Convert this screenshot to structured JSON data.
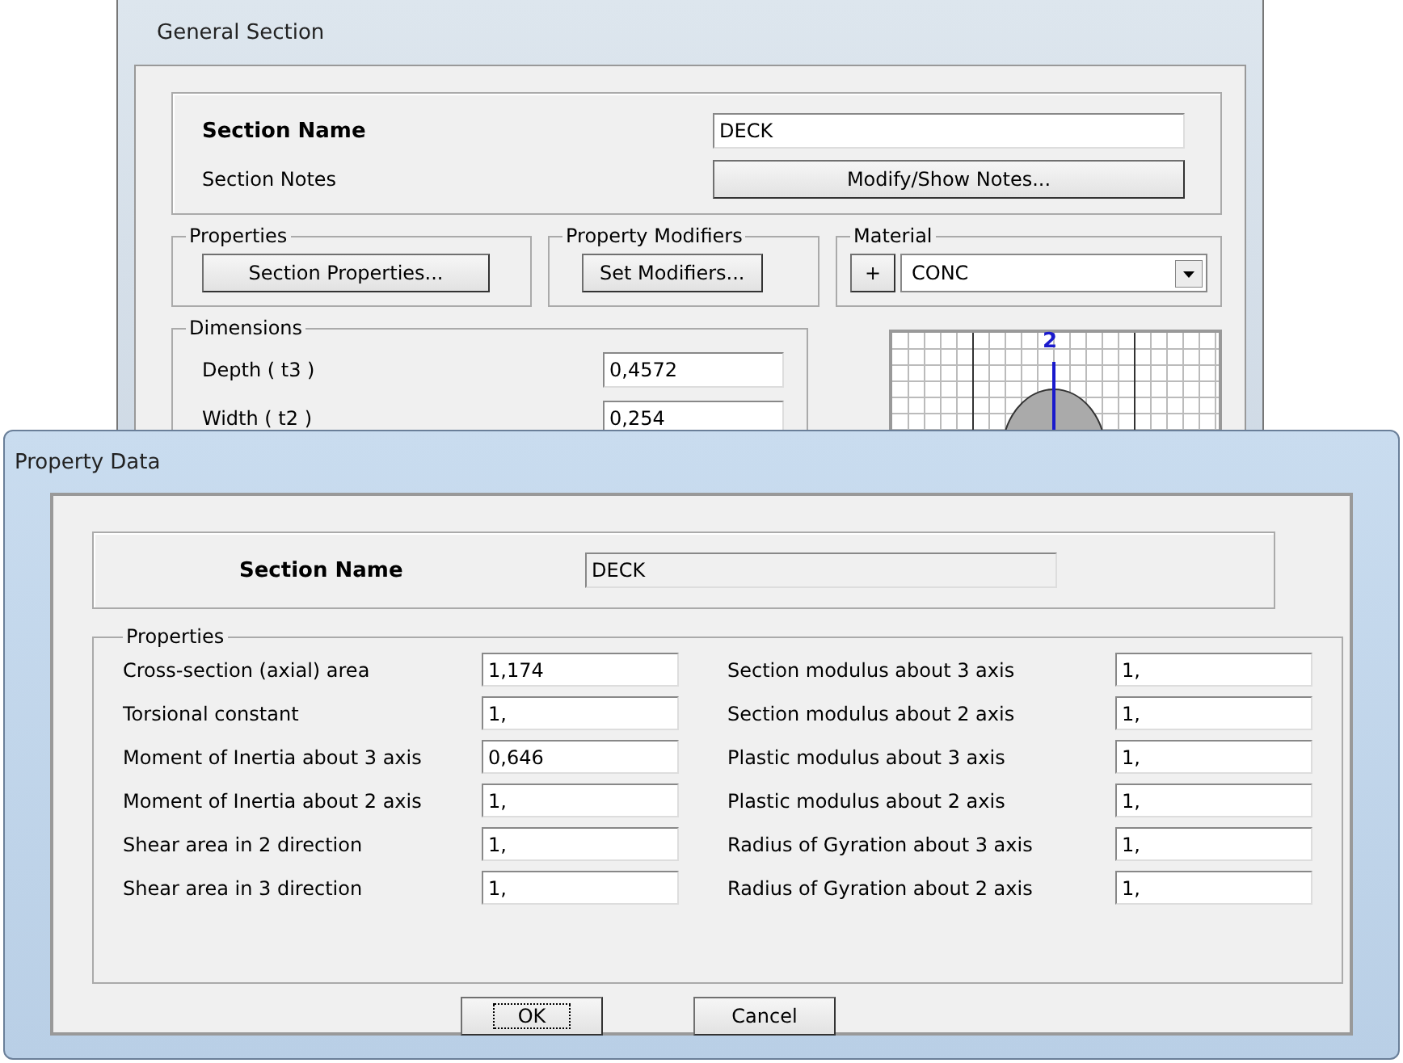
{
  "general_section": {
    "title": "General Section",
    "section_name": {
      "label": "Section Name",
      "value": "DECK"
    },
    "section_notes": {
      "label": "Section Notes",
      "button": "Modify/Show Notes..."
    },
    "properties": {
      "legend": "Properties",
      "button": "Section Properties..."
    },
    "property_modifiers": {
      "legend": "Property Modifiers",
      "button": "Set Modifiers..."
    },
    "material": {
      "legend": "Material",
      "add_button": "+",
      "value": "CONC"
    },
    "dimensions": {
      "legend": "Dimensions",
      "fields": [
        {
          "label": "Depth  ( t3 )",
          "value": "0,4572"
        },
        {
          "label": "Width  ( t2 )",
          "value": "0,254"
        }
      ]
    },
    "preview": {
      "axis_label": "2"
    }
  },
  "property_data": {
    "title": "Property Data",
    "section_name": {
      "label": "Section Name",
      "value": "DECK"
    },
    "properties": {
      "legend": "Properties",
      "left": [
        {
          "label": "Cross-section (axial) area",
          "value": "1,174"
        },
        {
          "label": "Torsional constant",
          "value": "1,"
        },
        {
          "label": "Moment of Inertia about 3 axis",
          "value": "0,646"
        },
        {
          "label": "Moment of Inertia about 2 axis",
          "value": "1,"
        },
        {
          "label": "Shear area in 2 direction",
          "value": "1,"
        },
        {
          "label": "Shear area in 3 direction",
          "value": "1,"
        }
      ],
      "right": [
        {
          "label": "Section modulus about 3 axis",
          "value": "1,"
        },
        {
          "label": "Section modulus about 2 axis",
          "value": "1,"
        },
        {
          "label": "Plastic modulus about 3 axis",
          "value": "1,"
        },
        {
          "label": "Plastic modulus about 2 axis",
          "value": "1,"
        },
        {
          "label": "Radius of Gyration about 3 axis",
          "value": "1,"
        },
        {
          "label": "Radius of Gyration about 2 axis",
          "value": "1,"
        }
      ]
    },
    "buttons": [
      {
        "label": "OK",
        "focused": true
      },
      {
        "label": "Cancel",
        "focused": false
      }
    ]
  }
}
